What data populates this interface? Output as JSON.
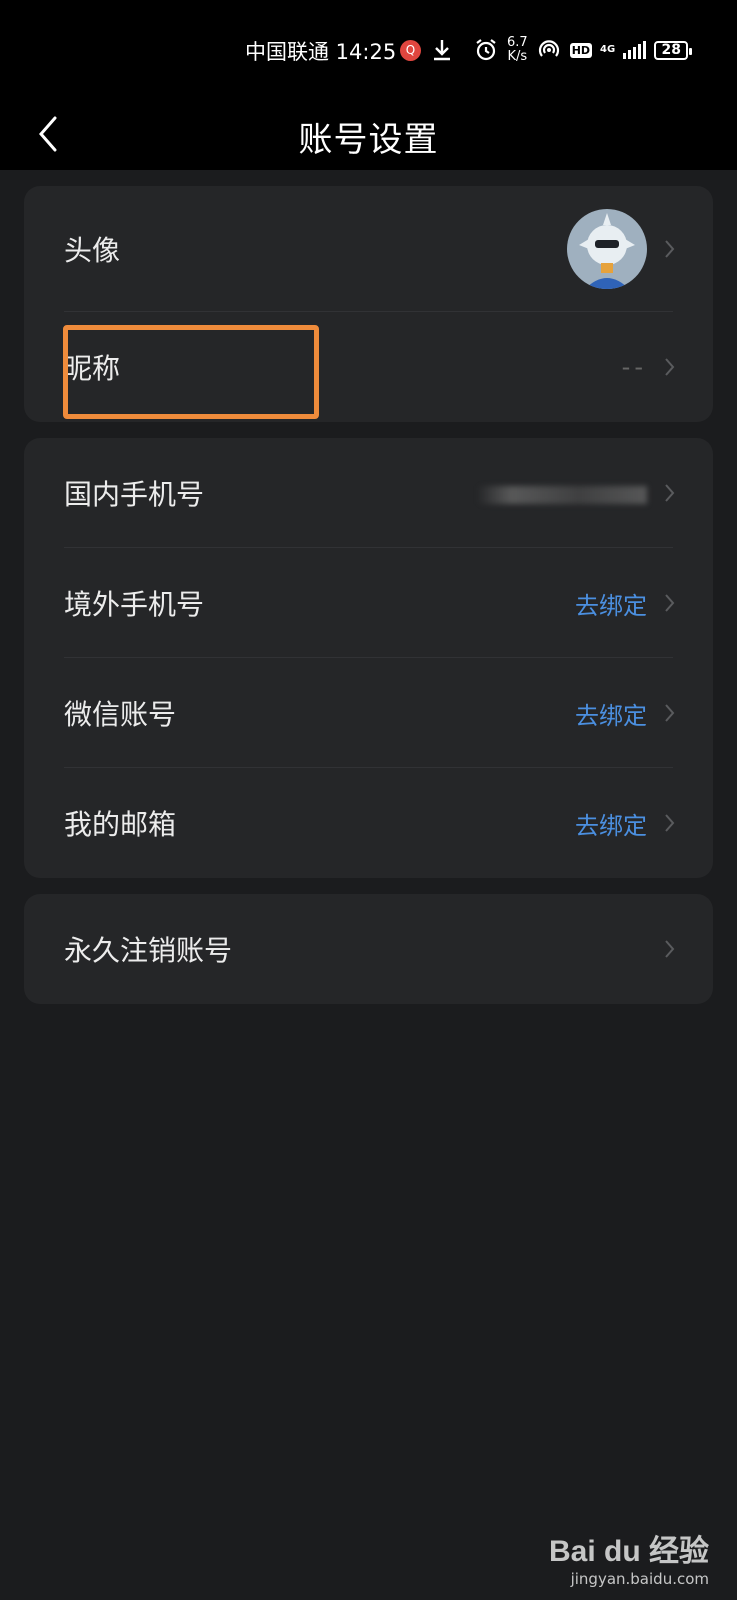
{
  "status_bar": {
    "carrier_time": "中国联通 14:25",
    "speed_value": "6.7",
    "speed_unit": "K/s",
    "hd": "HD",
    "network": "4G",
    "battery": "28",
    "icons": [
      "notification-icon",
      "download-icon",
      "alarm-icon",
      "hotspot-icon",
      "signal-icon",
      "battery-icon"
    ]
  },
  "header": {
    "title": "账号设置",
    "back_icon": "chevron-left-icon"
  },
  "section_profile": [
    {
      "label": "头像",
      "value": ""
    },
    {
      "label": "昵称",
      "value": "--"
    }
  ],
  "section_bindings": [
    {
      "label": "国内手机号",
      "value": ""
    },
    {
      "label": "境外手机号",
      "value": "去绑定"
    },
    {
      "label": "微信账号",
      "value": "去绑定"
    },
    {
      "label": "我的邮箱",
      "value": "去绑定"
    }
  ],
  "section_danger": [
    {
      "label": "永久注销账号"
    }
  ],
  "watermark": {
    "logo": "Bai du 经验",
    "url": "jingyan.baidu.com"
  },
  "colors": {
    "accent_link": "#4b8fe0",
    "highlight": "#ef8b3b",
    "background": "#1b1c1e",
    "card": "#252628"
  }
}
